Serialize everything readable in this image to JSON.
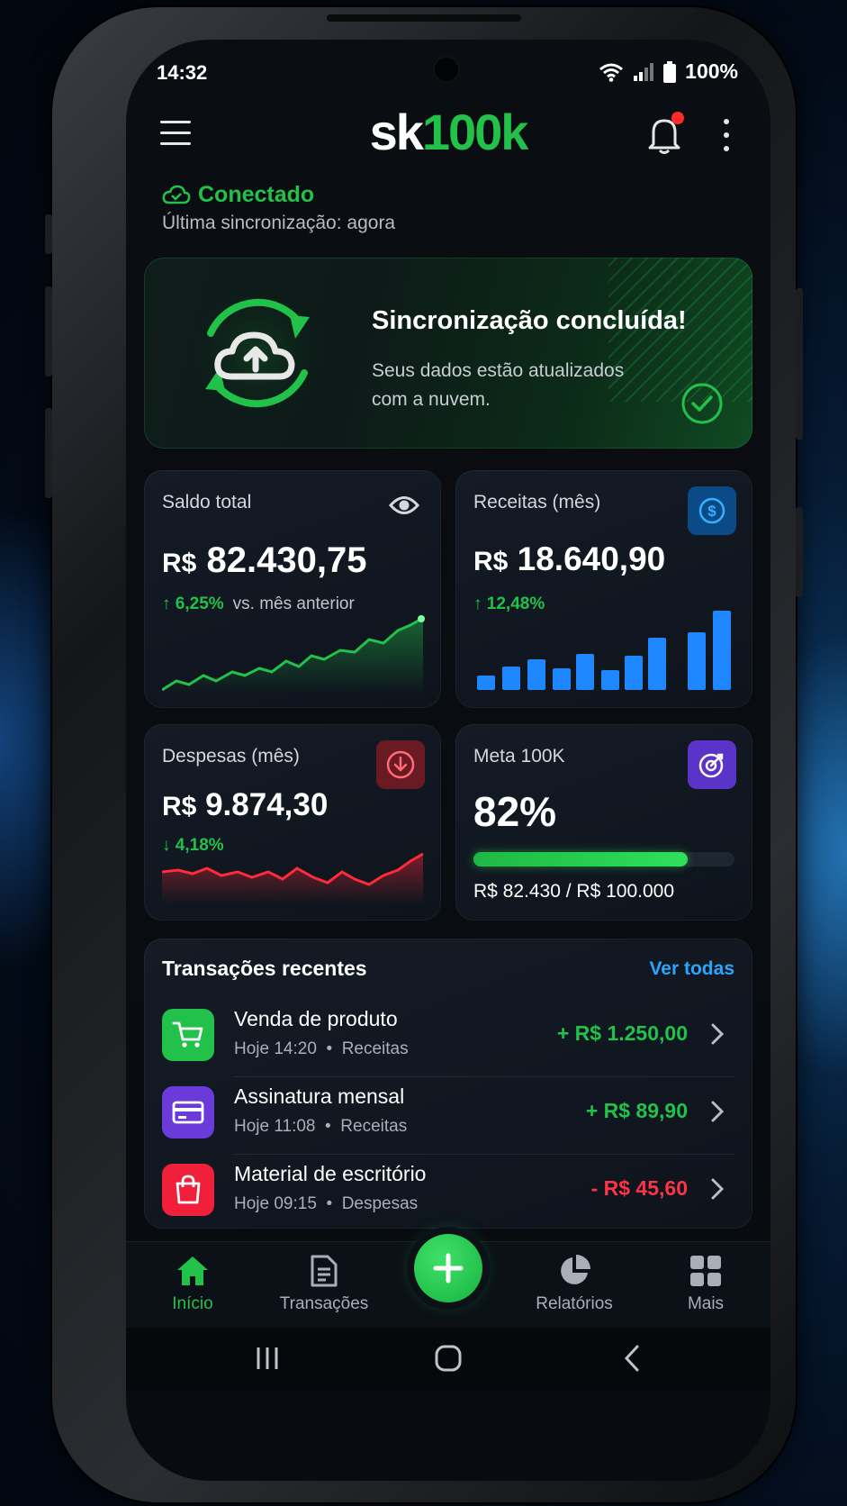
{
  "status_bar": {
    "time": "14:32",
    "battery": "100%"
  },
  "header": {
    "logo_part1": "sk",
    "logo_part2": "100k"
  },
  "connection": {
    "status": "Conectado",
    "last_sync": "Última sincronização: agora"
  },
  "banner": {
    "title": "Sincronização concluída!",
    "text": "Seus dados estão atualizados com a nuvem."
  },
  "cards": {
    "balance": {
      "label": "Saldo total",
      "currency": "R$",
      "value": "82.430,75",
      "change": "↑ 6,25%",
      "change_note": "vs. mês anterior"
    },
    "income": {
      "label": "Receitas (mês)",
      "currency": "R$",
      "value": "18.640,90",
      "change": "↑ 12,48%"
    },
    "expenses": {
      "label": "Despesas (mês)",
      "currency": "R$",
      "value": "9.874,30",
      "change": "↓ 4,18%"
    },
    "goal": {
      "label": "Meta 100K",
      "value": "82%",
      "progress": 0.82,
      "detail": "R$ 82.430 / R$ 100.000"
    }
  },
  "transactions": {
    "title": "Transações recentes",
    "see_all": "Ver todas",
    "items": [
      {
        "name": "Venda de produto",
        "time": "Hoje 14:20",
        "category": "Receitas",
        "amount": "+ R$ 1.250,00",
        "color": "#22c24a",
        "icon": "cart-icon"
      },
      {
        "name": "Assinatura mensal",
        "time": "Hoje 11:08",
        "category": "Receitas",
        "amount": "+ R$ 89,90",
        "color": "#22c24a",
        "icon": "card-icon"
      },
      {
        "name": "Material de escritório",
        "time": "Hoje 09:15",
        "category": "Despesas",
        "amount": "- R$ 45,60",
        "color": "#ff3344",
        "icon": "bag-icon"
      }
    ]
  },
  "nav": {
    "home": "Início",
    "transactions": "Transações",
    "reports": "Relatórios",
    "more": "Mais"
  },
  "colors": {
    "accent": "#22c24a",
    "link": "#2aa6ff",
    "danger": "#ff3344",
    "goal_purple": "#6a3bd8"
  }
}
